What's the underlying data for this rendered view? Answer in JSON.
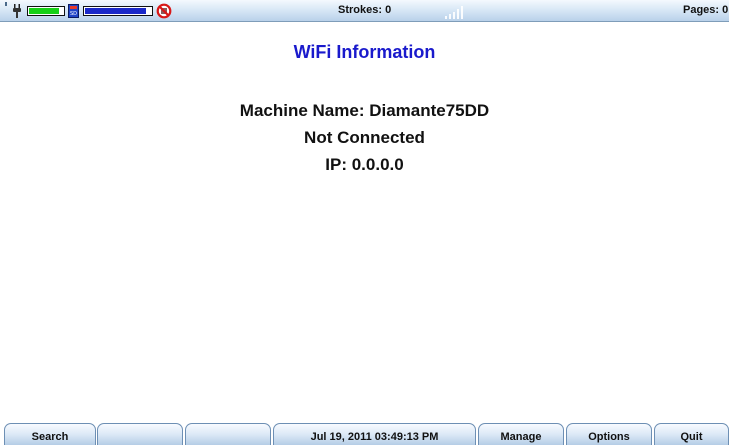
{
  "status_bar": {
    "strokes": "Strokes: 0",
    "pages": "Pages: 0",
    "battery_level": 0.9,
    "storage_level": 0.93,
    "colors": {
      "battery": "#16d016",
      "storage": "#1a28c8",
      "no_print": "#d81818"
    },
    "icons": [
      "plug-icon",
      "battery-icon",
      "sd-card-icon",
      "storage-icon",
      "no-printer-icon",
      "signal-icon"
    ]
  },
  "main": {
    "title": "WiFi Information",
    "machine_name": "Machine Name: Diamante75DD",
    "connection_status": "Not Connected",
    "ip": "IP: 0.0.0.0",
    "title_color": "#1a1acc"
  },
  "softkeys": {
    "search": "Search",
    "blank1": "",
    "blank2": "",
    "datetime": "Jul 19, 2011  03:49:13 PM",
    "manage": "Manage",
    "options": "Options",
    "quit": "Quit"
  }
}
